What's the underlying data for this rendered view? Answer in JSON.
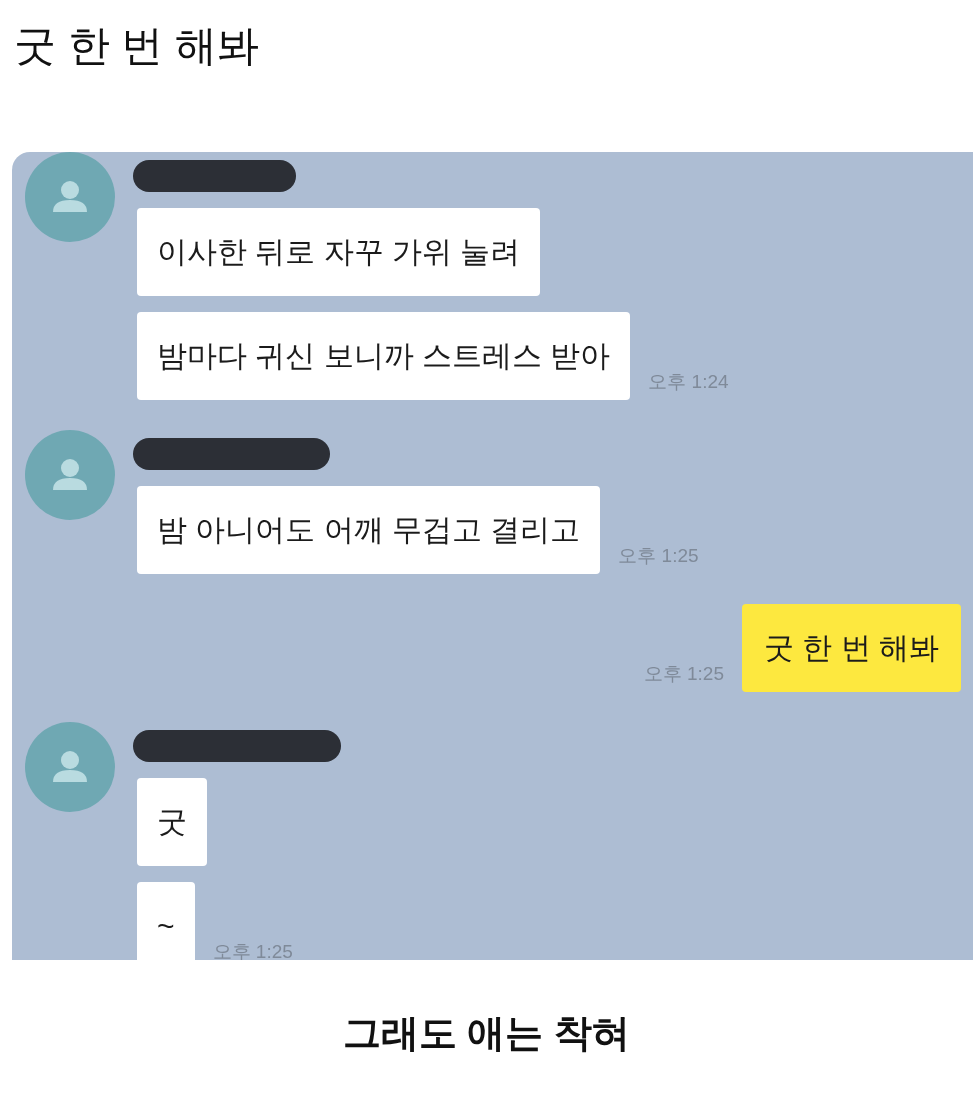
{
  "post_title": "굿 한 번 해봐",
  "chat": [
    {
      "kind": "incoming",
      "sender_redacted": true,
      "messages": [
        {
          "text": "이사한 뒤로 자꾸 가위 눌려"
        },
        {
          "text": "밤마다 귀신 보니까 스트레스 받아",
          "time": "오후 1:24"
        }
      ]
    },
    {
      "kind": "incoming",
      "sender_redacted": true,
      "messages": [
        {
          "text": "밤 아니어도 어깨 무겁고 결리고",
          "time": "오후 1:25"
        }
      ]
    },
    {
      "kind": "outgoing",
      "messages": [
        {
          "text": "굿 한 번 해봐",
          "time": "오후 1:25"
        }
      ]
    },
    {
      "kind": "incoming",
      "sender_redacted": true,
      "messages": [
        {
          "text": "굿"
        },
        {
          "text": "~",
          "time": "오후 1:25"
        }
      ]
    }
  ],
  "caption": "그래도 애는 착혀"
}
